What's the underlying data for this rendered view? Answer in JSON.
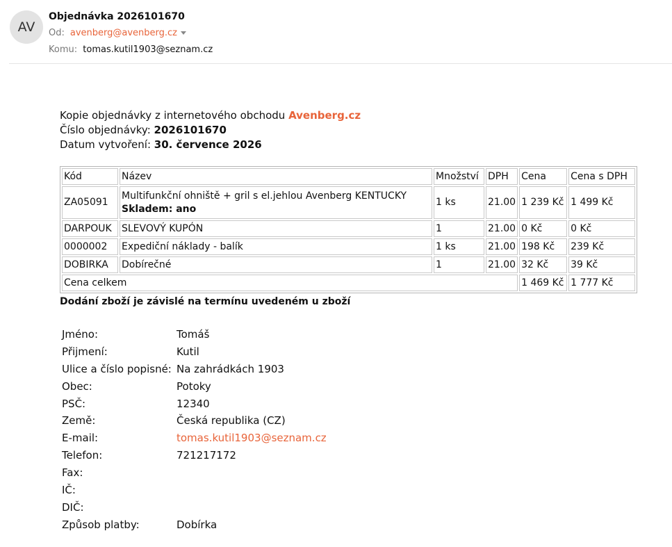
{
  "email": {
    "avatar_initials": "AV",
    "subject": "Objednávka 2026101670",
    "from_label": "Od:",
    "from_email": "avenberg@avenberg.cz",
    "to_label": "Komu:",
    "to_email": "tomas.kutil1903@seznam.cz"
  },
  "intro": {
    "line1_text": "Kopie objednávky z internetového obchodu ",
    "shop_name": "Avenberg.cz",
    "order_number_label": "Číslo objednávky: ",
    "order_number": "2026101670",
    "created_label": "Datum vytvoření: ",
    "created_date": "30. července 2026"
  },
  "order_table": {
    "headers": [
      "Kód",
      "Název",
      "Množství",
      "DPH",
      "Cena",
      "Cena s DPH"
    ],
    "rows": [
      {
        "code": "ZA05091",
        "name": "Multifunkční ohniště + gril s el.jehlou Avenberg KENTUCKY",
        "stock": "Skladem: ano",
        "qty": "1 ks",
        "vat": "21.00",
        "price": "1 239 Kč",
        "price_vat": "1 499 Kč"
      },
      {
        "code": "DARPOUK",
        "name": "SLEVOVÝ KUPÓN",
        "qty": "1",
        "vat": "21.00",
        "price": "0 Kč",
        "price_vat": "0 Kč"
      },
      {
        "code": "0000002",
        "name": "Expediční náklady - balík",
        "qty": "1 ks",
        "vat": "21.00",
        "price": "198 Kč",
        "price_vat": "239 Kč"
      },
      {
        "code": "DOBIRKA",
        "name": "Dobírečné",
        "qty": "1",
        "vat": "21.00",
        "price": "32 Kč",
        "price_vat": "39 Kč"
      }
    ],
    "total_label": "Cena celkem",
    "total_price": "1 469 Kč",
    "total_price_vat": "1 777 Kč"
  },
  "delivery_note": "Dodání zboží je závislé na termínu uvedeném u zboží",
  "customer": [
    {
      "label": "Jméno:",
      "value": "Tomáš"
    },
    {
      "label": "Přijmení:",
      "value": "Kutil"
    },
    {
      "label": "Ulice a číslo popisné:",
      "value": "Na zahrádkách 1903"
    },
    {
      "label": "Obec:",
      "value": "Potoky"
    },
    {
      "label": "PSČ:",
      "value": "12340"
    },
    {
      "label": "Země:",
      "value": "Česká republika (CZ)"
    },
    {
      "label": "E-mail:",
      "value": "tomas.kutil1903@seznam.cz"
    },
    {
      "label": "Telefon:",
      "value": "721217172"
    },
    {
      "label": "Fax:",
      "value": ""
    },
    {
      "label": "IČ:",
      "value": ""
    },
    {
      "label": "DIČ:",
      "value": ""
    },
    {
      "label": "Způsob platby:",
      "value": "Dobírka"
    }
  ],
  "colors": {
    "accent": "#e8643a",
    "avatar_bg": "#e3e3e3"
  }
}
